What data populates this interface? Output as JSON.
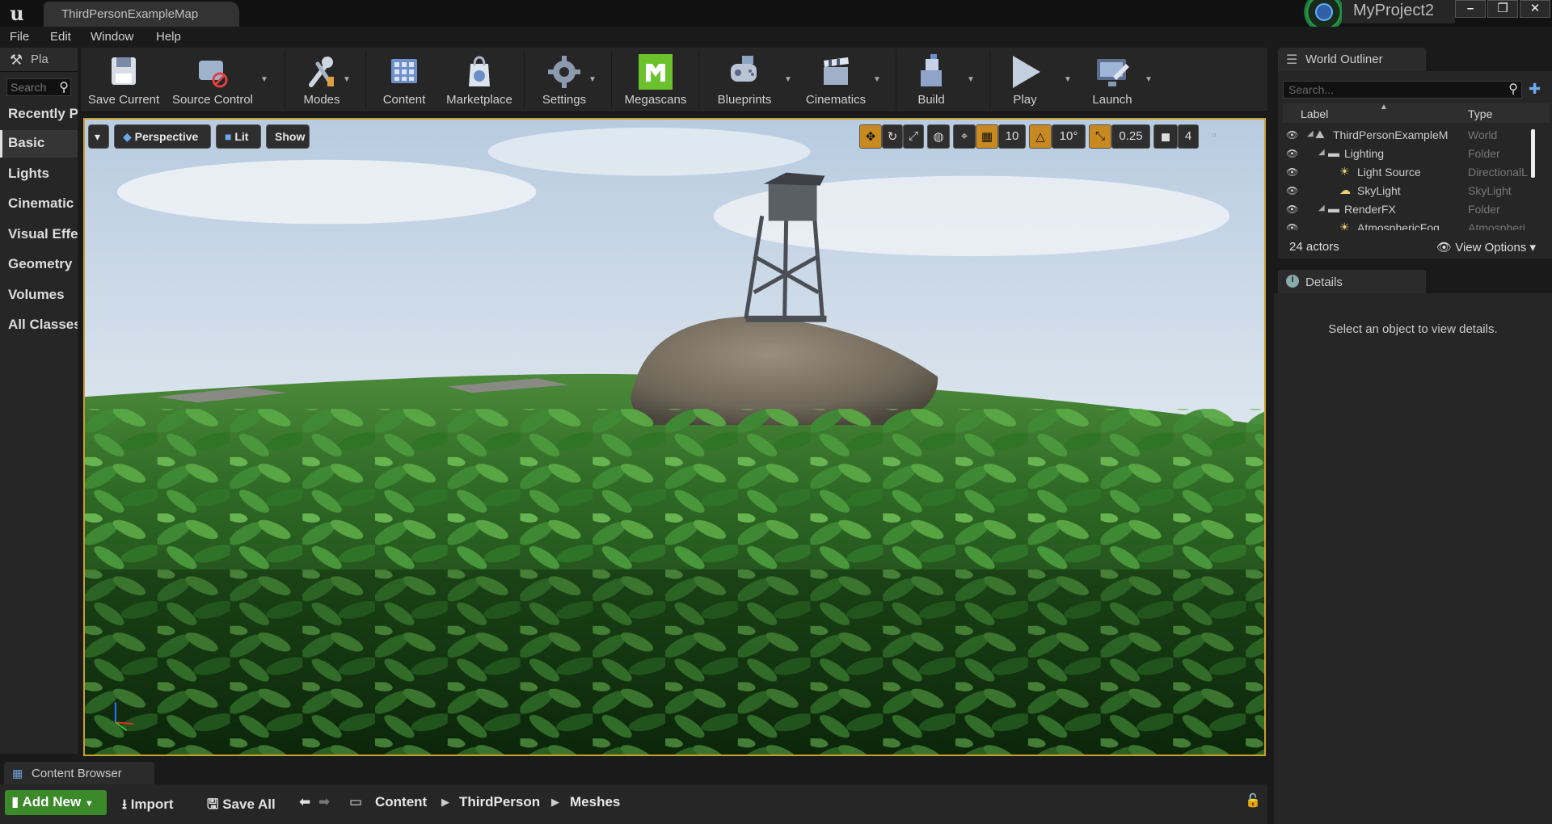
{
  "window": {
    "map_tab": "ThirdPersonExampleMap",
    "project_name": "MyProject2",
    "minimize": "–",
    "restore": "❐",
    "close": "✕"
  },
  "menu": [
    "File",
    "Edit",
    "Window",
    "Help"
  ],
  "modes_panel": {
    "tab_label": "Pla",
    "search_placeholder": "Search",
    "categories": [
      "Recently P",
      "Basic",
      "Lights",
      "Cinematic",
      "Visual Effe",
      "Geometry",
      "Volumes",
      "All Classes"
    ],
    "active_category": "Basic"
  },
  "toolbar": {
    "save_current": "Save Current",
    "source_control": "Source Control",
    "modes": "Modes",
    "content": "Content",
    "marketplace": "Marketplace",
    "settings": "Settings",
    "megascans": "Megascans",
    "blueprints": "Blueprints",
    "cinematics": "Cinematics",
    "build": "Build",
    "play": "Play",
    "launch": "Launch"
  },
  "viewport": {
    "perspective": "Perspective",
    "lit": "Lit",
    "show": "Show",
    "grid_snap": "10",
    "rotation_snap": "10°",
    "scale_snap": "0.25",
    "camera_speed": "4"
  },
  "world_outliner": {
    "tab_label": "World Outliner",
    "search_placeholder": "Search...",
    "col_label": "Label",
    "col_type": "Type",
    "rows": [
      {
        "label": "ThirdPersonExampleM",
        "type": "World"
      },
      {
        "label": "Lighting",
        "type": "Folder"
      },
      {
        "label": "Light Source",
        "type": "DirectionalL"
      },
      {
        "label": "SkyLight",
        "type": "SkyLight"
      },
      {
        "label": "RenderFX",
        "type": "Folder"
      },
      {
        "label": "AtmosphericFog",
        "type": "Atmospheri"
      }
    ],
    "actor_count": "24 actors",
    "view_options": "View Options"
  },
  "details": {
    "tab_label": "Details",
    "empty_text": "Select an object to view details."
  },
  "content_browser": {
    "tab_label": "Content Browser",
    "add_new": "Add New",
    "import": "Import",
    "save_all": "Save All",
    "path": [
      "Content",
      "ThirdPerson",
      "Meshes"
    ]
  },
  "colors": {
    "accent_orange": "#c88a20",
    "add_new_green": "#3a8a2a",
    "viewport_border": "#c8a030"
  }
}
